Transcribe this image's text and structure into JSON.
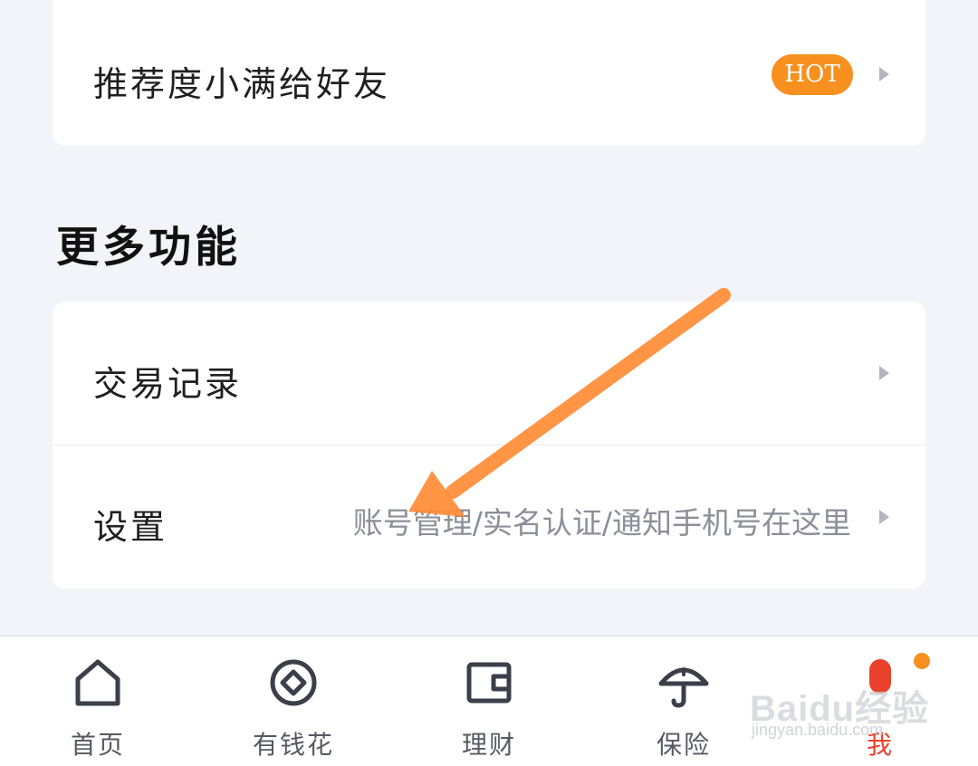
{
  "top_card": {
    "item_label": "推荐度小满给好友",
    "badge": "HOT"
  },
  "section": {
    "title": "更多功能"
  },
  "more_card": {
    "items": [
      {
        "label": "交易记录",
        "hint": ""
      },
      {
        "label": "设置",
        "hint": "账号管理/实名认证/通知手机号在这里"
      }
    ]
  },
  "tabbar": {
    "tabs": [
      {
        "label": "首页",
        "icon": "home-icon",
        "active": false
      },
      {
        "label": "有钱花",
        "icon": "coin-icon",
        "active": false
      },
      {
        "label": "理财",
        "icon": "wallet-icon",
        "active": false
      },
      {
        "label": "保险",
        "icon": "umbrella-icon",
        "active": false
      },
      {
        "label": "我",
        "icon": "profile-icon",
        "active": true
      }
    ]
  },
  "watermark": {
    "brand": "Baidu经验",
    "url": "jingyan.baidu.com"
  },
  "colors": {
    "background": "#f2f4f9",
    "accent_orange": "#f7901e",
    "active_red": "#e9412b",
    "arrow": "#ff8c35"
  }
}
